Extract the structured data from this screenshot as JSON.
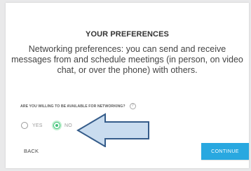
{
  "panel": {
    "title": "YOUR PREFERENCES",
    "description": "Networking preferences: you can send and receive messages from and schedule meetings (in person, on video chat, or over the phone) with others."
  },
  "question": {
    "label": "ARE YOU WILLING TO BE AVAILABLE FOR NETWORKING?",
    "help_icon_glyph": "?"
  },
  "options": {
    "yes": {
      "label": "YES",
      "selected": false
    },
    "no": {
      "label": "NO",
      "selected": true
    }
  },
  "actions": {
    "back_label": "BACK",
    "continue_label": "CONTINUE"
  },
  "colors": {
    "accent": "#29a8e0",
    "selected": "#42c07a",
    "arrow_fill": "#c9dcef",
    "arrow_stroke": "#355c8a"
  },
  "icons": {
    "help": "help-circle-icon",
    "arrow": "left-arrow-icon"
  }
}
